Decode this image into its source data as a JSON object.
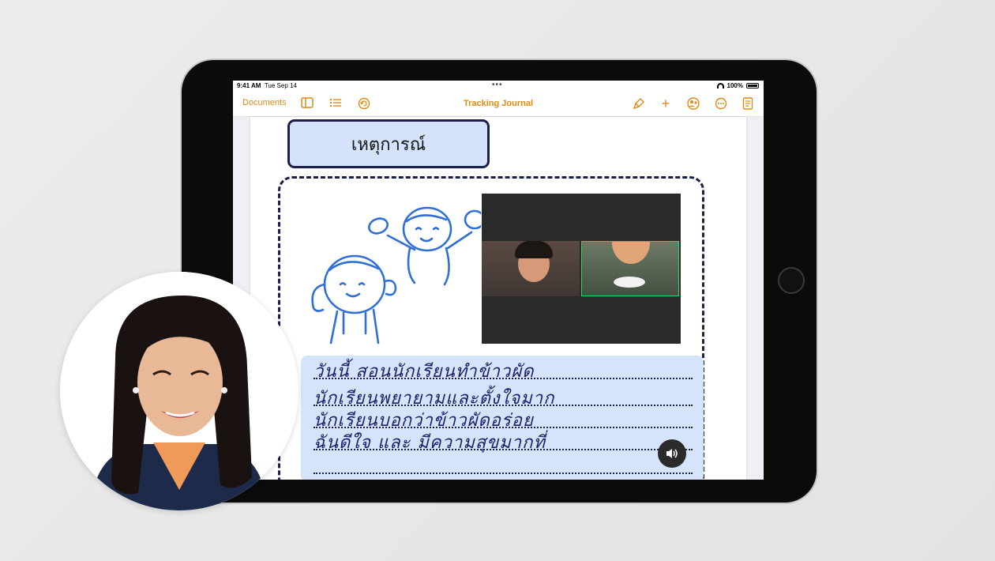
{
  "status_bar": {
    "time": "9:41 AM",
    "date": "Tue Sep 14",
    "battery": "100%"
  },
  "toolbar": {
    "documents_label": "Documents",
    "title": "Tracking Journal"
  },
  "page": {
    "heading": "เหตุการณ์",
    "lines": [
      "วันนี้ สอนนักเรียนทำข้าวผัด",
      "นักเรียนพยายามและตั้งใจมาก",
      "นักเรียนบอกว่าข้าวผัดอร่อย",
      "ฉันดีใจ และ มีความสุขมากที่",
      ""
    ]
  },
  "video_call": {
    "participants": [
      "",
      ""
    ]
  },
  "colors": {
    "accent": "#e08a14",
    "ink": "#1b1f4a",
    "panel": "#d6e4fb",
    "sketch": "#2f6fd6"
  }
}
